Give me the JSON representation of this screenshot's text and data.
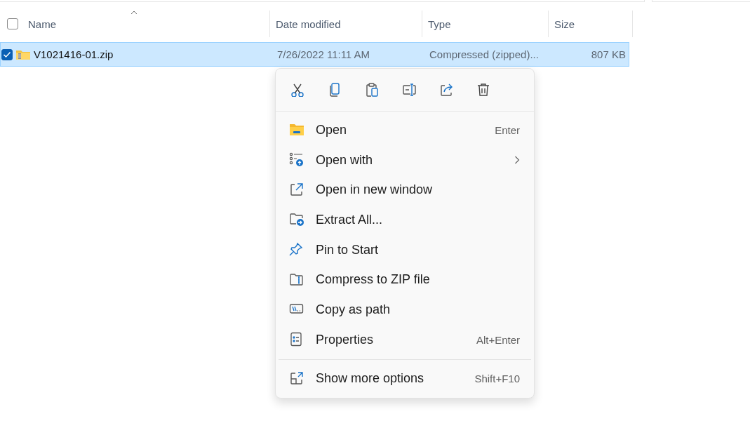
{
  "file_list": {
    "select_all": {
      "checked": false
    },
    "columns": [
      {
        "label": "Name",
        "sorted": true
      },
      {
        "label": "Date modified",
        "sorted": false
      },
      {
        "label": "Type",
        "sorted": false
      },
      {
        "label": "Size",
        "sorted": false
      }
    ],
    "rows": [
      {
        "name": "V1021416-01.zip",
        "date_modified": "7/26/2022 11:11 AM",
        "type": "Compressed (zipped)...",
        "size": "807 KB",
        "selected": true,
        "checked": true
      }
    ]
  },
  "context_menu": {
    "toolbar": [
      {
        "kind": "cut"
      },
      {
        "kind": "copy"
      },
      {
        "kind": "paste"
      },
      {
        "kind": "rename"
      },
      {
        "kind": "share"
      },
      {
        "kind": "delete"
      }
    ],
    "items": [
      {
        "kind": "command",
        "label": "Open",
        "shortcut": "Enter"
      },
      {
        "kind": "command",
        "label": "Open with",
        "submenu": true
      },
      {
        "kind": "command",
        "label": "Open in new window"
      },
      {
        "kind": "command",
        "label": "Extract All..."
      },
      {
        "kind": "command",
        "label": "Pin to Start"
      },
      {
        "kind": "command",
        "label": "Compress to ZIP file"
      },
      {
        "kind": "command",
        "label": "Copy as path"
      },
      {
        "kind": "command",
        "label": "Properties",
        "shortcut": "Alt+Enter"
      },
      {
        "kind": "separator"
      },
      {
        "kind": "command",
        "label": "Show more options",
        "shortcut": "Shift+F10"
      }
    ]
  }
}
